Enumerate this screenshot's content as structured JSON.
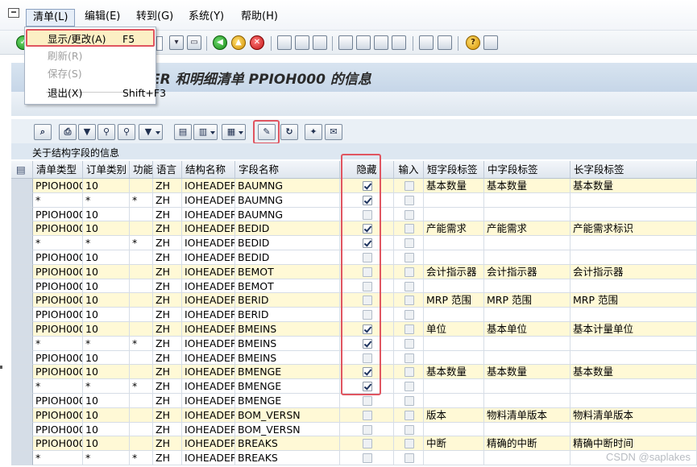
{
  "menu": {
    "items": [
      "清单(L)",
      "编辑(E)",
      "转到(G)",
      "系统(Y)",
      "帮助(H)"
    ],
    "dropdown": [
      {
        "label": "显示/更改(A)",
        "shortcut": "F5",
        "state": "highlighted"
      },
      {
        "label": "刷新(R)",
        "shortcut": "",
        "state": "disabled"
      },
      {
        "label": "保存(S)",
        "shortcut": "",
        "state": "disabled"
      },
      {
        "label": "退出(X)",
        "shortcut": "Shift+F3",
        "state": "normal"
      }
    ]
  },
  "title": "ER 和明细清单 PPIOH000 的信息",
  "table_title": "关于结构字段的信息",
  "columns": [
    "清单类型",
    "订单类别",
    "功能",
    "语言",
    "结构名称",
    "字段名称",
    "隐藏",
    "输入",
    "短字段标签",
    "中字段标签",
    "长字段标签"
  ],
  "rows": [
    {
      "type": "PPIOH000",
      "cat": "10",
      "func": "",
      "lang": "ZH",
      "struct": "IOHEADER",
      "field": "BAUMNG",
      "hidden": true,
      "short": "基本数量",
      "mid": "基本数量",
      "long": "基本数量"
    },
    {
      "type": "*",
      "cat": "*",
      "func": "*",
      "lang": "ZH",
      "struct": "IOHEADER",
      "field": "BAUMNG",
      "hidden": true,
      "short": "",
      "mid": "",
      "long": ""
    },
    {
      "type": "PPIOH000",
      "cat": "10",
      "func": "",
      "lang": "ZH",
      "struct": "IOHEADER",
      "field": "BAUMNG",
      "hidden": false,
      "short": "",
      "mid": "",
      "long": ""
    },
    {
      "type": "PPIOH000",
      "cat": "10",
      "func": "",
      "lang": "ZH",
      "struct": "IOHEADER",
      "field": "BEDID",
      "hidden": true,
      "short": "产能需求",
      "mid": "产能需求",
      "long": "产能需求标识"
    },
    {
      "type": "*",
      "cat": "*",
      "func": "*",
      "lang": "ZH",
      "struct": "IOHEADER",
      "field": "BEDID",
      "hidden": true,
      "short": "",
      "mid": "",
      "long": ""
    },
    {
      "type": "PPIOH000",
      "cat": "10",
      "func": "",
      "lang": "ZH",
      "struct": "IOHEADER",
      "field": "BEDID",
      "hidden": false,
      "short": "",
      "mid": "",
      "long": ""
    },
    {
      "type": "PPIOH000",
      "cat": "10",
      "func": "",
      "lang": "ZH",
      "struct": "IOHEADER",
      "field": "BEMOT",
      "hidden": false,
      "short": "会计指示器",
      "mid": "会计指示器",
      "long": "会计指示器"
    },
    {
      "type": "PPIOH000",
      "cat": "10",
      "func": "",
      "lang": "ZH",
      "struct": "IOHEADER",
      "field": "BEMOT",
      "hidden": false,
      "short": "",
      "mid": "",
      "long": ""
    },
    {
      "type": "PPIOH000",
      "cat": "10",
      "func": "",
      "lang": "ZH",
      "struct": "IOHEADER",
      "field": "BERID",
      "hidden": false,
      "short": "MRP 范围",
      "mid": "MRP 范围",
      "long": "MRP 范围"
    },
    {
      "type": "PPIOH000",
      "cat": "10",
      "func": "",
      "lang": "ZH",
      "struct": "IOHEADER",
      "field": "BERID",
      "hidden": false,
      "short": "",
      "mid": "",
      "long": ""
    },
    {
      "type": "PPIOH000",
      "cat": "10",
      "func": "",
      "lang": "ZH",
      "struct": "IOHEADER",
      "field": "BMEINS",
      "hidden": true,
      "short": "单位",
      "mid": "基本单位",
      "long": "基本计量单位"
    },
    {
      "type": "*",
      "cat": "*",
      "func": "*",
      "lang": "ZH",
      "struct": "IOHEADER",
      "field": "BMEINS",
      "hidden": true,
      "short": "",
      "mid": "",
      "long": ""
    },
    {
      "type": "PPIOH000",
      "cat": "10",
      "func": "",
      "lang": "ZH",
      "struct": "IOHEADER",
      "field": "BMEINS",
      "hidden": false,
      "short": "",
      "mid": "",
      "long": ""
    },
    {
      "type": "PPIOH000",
      "cat": "10",
      "func": "",
      "lang": "ZH",
      "struct": "IOHEADER",
      "field": "BMENGE",
      "hidden": true,
      "short": "基本数量",
      "mid": "基本数量",
      "long": "基本数量"
    },
    {
      "type": "*",
      "cat": "*",
      "func": "*",
      "lang": "ZH",
      "struct": "IOHEADER",
      "field": "BMENGE",
      "hidden": true,
      "short": "",
      "mid": "",
      "long": ""
    },
    {
      "type": "PPIOH000",
      "cat": "10",
      "func": "",
      "lang": "ZH",
      "struct": "IOHEADER",
      "field": "BMENGE",
      "hidden": false,
      "short": "",
      "mid": "",
      "long": ""
    },
    {
      "type": "PPIOH000",
      "cat": "10",
      "func": "",
      "lang": "ZH",
      "struct": "IOHEADER",
      "field": "BOM_VERSN",
      "hidden": false,
      "short": "版本",
      "mid": "物料清单版本",
      "long": "物料清单版本"
    },
    {
      "type": "PPIOH000",
      "cat": "10",
      "func": "",
      "lang": "ZH",
      "struct": "IOHEADER",
      "field": "BOM_VERSN",
      "hidden": false,
      "short": "",
      "mid": "",
      "long": ""
    },
    {
      "type": "PPIOH000",
      "cat": "10",
      "func": "",
      "lang": "ZH",
      "struct": "IOHEADER",
      "field": "BREAKS",
      "hidden": false,
      "short": "中断",
      "mid": "精确的中断",
      "long": "精确中断时间"
    },
    {
      "type": "*",
      "cat": "*",
      "func": "*",
      "lang": "ZH",
      "struct": "IOHEADER",
      "field": "BREAKS",
      "hidden": false,
      "short": "",
      "mid": "",
      "long": ""
    }
  ],
  "watermark": "CSDN @saplakes"
}
